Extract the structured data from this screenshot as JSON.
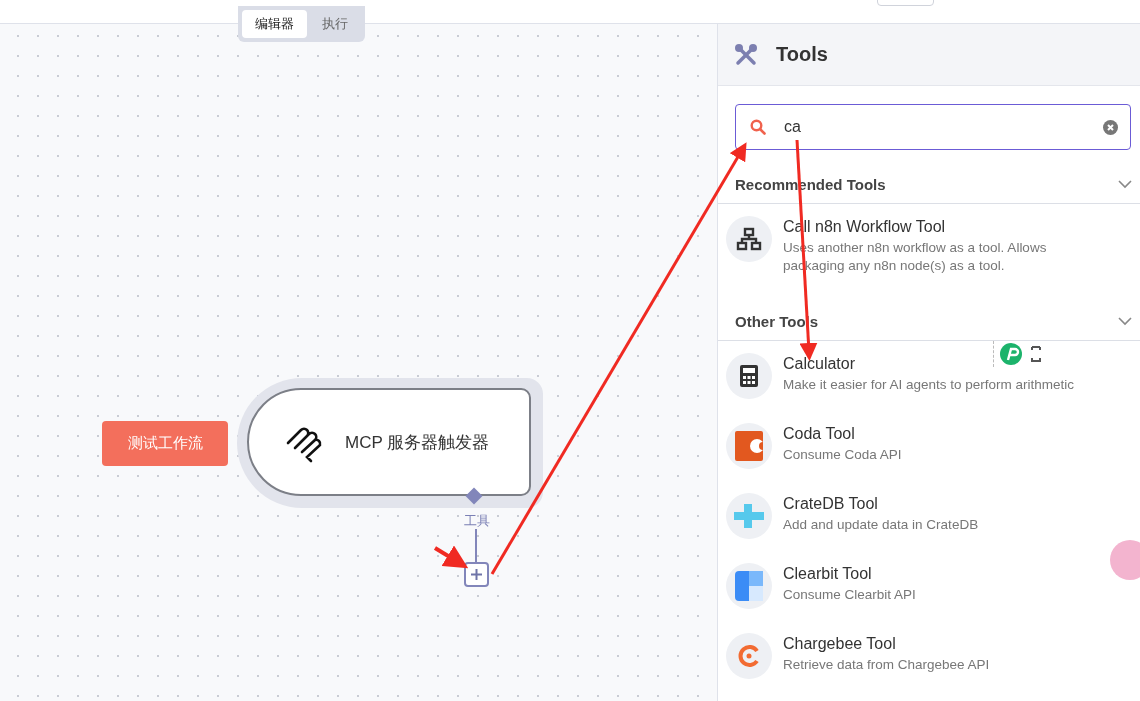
{
  "canvas": {
    "tabs": [
      {
        "label": "编辑器",
        "selected": true
      },
      {
        "label": "执行",
        "selected": false
      }
    ],
    "test_button": "测试工作流",
    "node": {
      "title": "MCP 服务器触发器",
      "connector_label": "工具"
    }
  },
  "panel": {
    "title": "Tools",
    "search": {
      "value": "ca"
    },
    "sections": [
      {
        "title": "Recommended Tools",
        "expanded": true,
        "items": [
          {
            "kind": "network",
            "title": "Call n8n Workflow Tool",
            "description": "Uses another n8n workflow as a tool. Allows packaging any n8n node(s) as a tool."
          }
        ]
      },
      {
        "title": "Other Tools",
        "expanded": true,
        "items": [
          {
            "kind": "calculator",
            "title": "Calculator",
            "description": "Make it easier for AI agents to perform arithmetic"
          },
          {
            "kind": "coda",
            "title": "Coda Tool",
            "description": "Consume Coda API"
          },
          {
            "kind": "cross",
            "title": "CrateDB Tool",
            "description": "Add and update data in CrateDB"
          },
          {
            "kind": "quarters",
            "title": "Clearbit Tool",
            "description": "Consume Clearbit API"
          },
          {
            "kind": "ring",
            "title": "Chargebee Tool",
            "description": "Retrieve data from Chargebee API"
          }
        ]
      }
    ]
  }
}
